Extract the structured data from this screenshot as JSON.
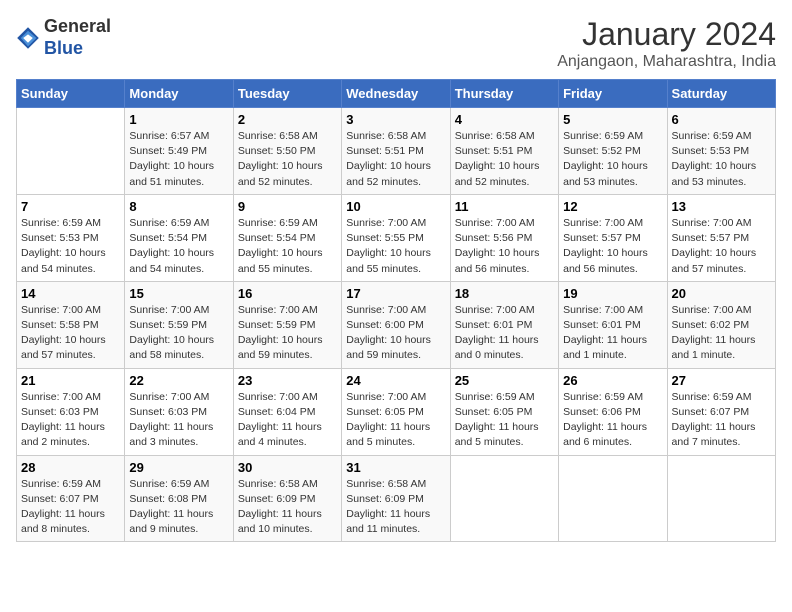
{
  "header": {
    "logo_general": "General",
    "logo_blue": "Blue",
    "month_title": "January 2024",
    "subtitle": "Anjangaon, Maharashtra, India"
  },
  "days_of_week": [
    "Sunday",
    "Monday",
    "Tuesday",
    "Wednesday",
    "Thursday",
    "Friday",
    "Saturday"
  ],
  "weeks": [
    [
      {
        "num": "",
        "detail": ""
      },
      {
        "num": "1",
        "detail": "Sunrise: 6:57 AM\nSunset: 5:49 PM\nDaylight: 10 hours\nand 51 minutes."
      },
      {
        "num": "2",
        "detail": "Sunrise: 6:58 AM\nSunset: 5:50 PM\nDaylight: 10 hours\nand 52 minutes."
      },
      {
        "num": "3",
        "detail": "Sunrise: 6:58 AM\nSunset: 5:51 PM\nDaylight: 10 hours\nand 52 minutes."
      },
      {
        "num": "4",
        "detail": "Sunrise: 6:58 AM\nSunset: 5:51 PM\nDaylight: 10 hours\nand 52 minutes."
      },
      {
        "num": "5",
        "detail": "Sunrise: 6:59 AM\nSunset: 5:52 PM\nDaylight: 10 hours\nand 53 minutes."
      },
      {
        "num": "6",
        "detail": "Sunrise: 6:59 AM\nSunset: 5:53 PM\nDaylight: 10 hours\nand 53 minutes."
      }
    ],
    [
      {
        "num": "7",
        "detail": "Sunrise: 6:59 AM\nSunset: 5:53 PM\nDaylight: 10 hours\nand 54 minutes."
      },
      {
        "num": "8",
        "detail": "Sunrise: 6:59 AM\nSunset: 5:54 PM\nDaylight: 10 hours\nand 54 minutes."
      },
      {
        "num": "9",
        "detail": "Sunrise: 6:59 AM\nSunset: 5:54 PM\nDaylight: 10 hours\nand 55 minutes."
      },
      {
        "num": "10",
        "detail": "Sunrise: 7:00 AM\nSunset: 5:55 PM\nDaylight: 10 hours\nand 55 minutes."
      },
      {
        "num": "11",
        "detail": "Sunrise: 7:00 AM\nSunset: 5:56 PM\nDaylight: 10 hours\nand 56 minutes."
      },
      {
        "num": "12",
        "detail": "Sunrise: 7:00 AM\nSunset: 5:57 PM\nDaylight: 10 hours\nand 56 minutes."
      },
      {
        "num": "13",
        "detail": "Sunrise: 7:00 AM\nSunset: 5:57 PM\nDaylight: 10 hours\nand 57 minutes."
      }
    ],
    [
      {
        "num": "14",
        "detail": "Sunrise: 7:00 AM\nSunset: 5:58 PM\nDaylight: 10 hours\nand 57 minutes."
      },
      {
        "num": "15",
        "detail": "Sunrise: 7:00 AM\nSunset: 5:59 PM\nDaylight: 10 hours\nand 58 minutes."
      },
      {
        "num": "16",
        "detail": "Sunrise: 7:00 AM\nSunset: 5:59 PM\nDaylight: 10 hours\nand 59 minutes."
      },
      {
        "num": "17",
        "detail": "Sunrise: 7:00 AM\nSunset: 6:00 PM\nDaylight: 10 hours\nand 59 minutes."
      },
      {
        "num": "18",
        "detail": "Sunrise: 7:00 AM\nSunset: 6:01 PM\nDaylight: 11 hours\nand 0 minutes."
      },
      {
        "num": "19",
        "detail": "Sunrise: 7:00 AM\nSunset: 6:01 PM\nDaylight: 11 hours\nand 1 minute."
      },
      {
        "num": "20",
        "detail": "Sunrise: 7:00 AM\nSunset: 6:02 PM\nDaylight: 11 hours\nand 1 minute."
      }
    ],
    [
      {
        "num": "21",
        "detail": "Sunrise: 7:00 AM\nSunset: 6:03 PM\nDaylight: 11 hours\nand 2 minutes."
      },
      {
        "num": "22",
        "detail": "Sunrise: 7:00 AM\nSunset: 6:03 PM\nDaylight: 11 hours\nand 3 minutes."
      },
      {
        "num": "23",
        "detail": "Sunrise: 7:00 AM\nSunset: 6:04 PM\nDaylight: 11 hours\nand 4 minutes."
      },
      {
        "num": "24",
        "detail": "Sunrise: 7:00 AM\nSunset: 6:05 PM\nDaylight: 11 hours\nand 5 minutes."
      },
      {
        "num": "25",
        "detail": "Sunrise: 6:59 AM\nSunset: 6:05 PM\nDaylight: 11 hours\nand 5 minutes."
      },
      {
        "num": "26",
        "detail": "Sunrise: 6:59 AM\nSunset: 6:06 PM\nDaylight: 11 hours\nand 6 minutes."
      },
      {
        "num": "27",
        "detail": "Sunrise: 6:59 AM\nSunset: 6:07 PM\nDaylight: 11 hours\nand 7 minutes."
      }
    ],
    [
      {
        "num": "28",
        "detail": "Sunrise: 6:59 AM\nSunset: 6:07 PM\nDaylight: 11 hours\nand 8 minutes."
      },
      {
        "num": "29",
        "detail": "Sunrise: 6:59 AM\nSunset: 6:08 PM\nDaylight: 11 hours\nand 9 minutes."
      },
      {
        "num": "30",
        "detail": "Sunrise: 6:58 AM\nSunset: 6:09 PM\nDaylight: 11 hours\nand 10 minutes."
      },
      {
        "num": "31",
        "detail": "Sunrise: 6:58 AM\nSunset: 6:09 PM\nDaylight: 11 hours\nand 11 minutes."
      },
      {
        "num": "",
        "detail": ""
      },
      {
        "num": "",
        "detail": ""
      },
      {
        "num": "",
        "detail": ""
      }
    ]
  ]
}
